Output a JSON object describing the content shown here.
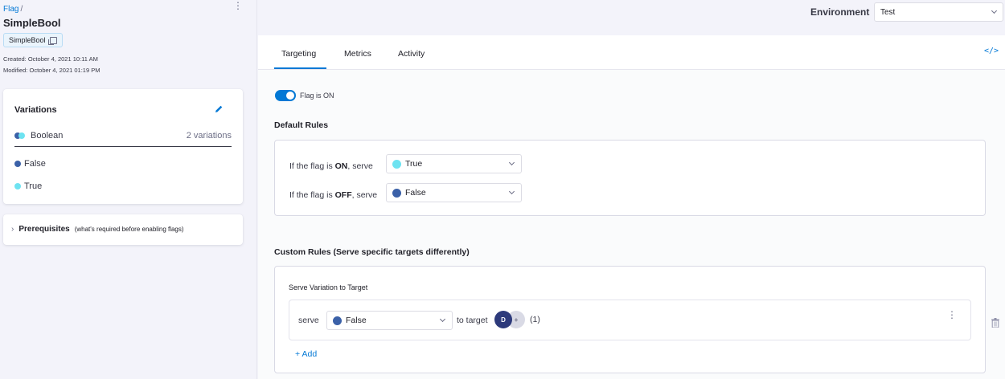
{
  "breadcrumb": {
    "parent": "Flag",
    "separator": "/"
  },
  "flag": {
    "title": "SimpleBool",
    "identifier": "SimpleBool",
    "created": "Created: October 4, 2021 10:11 AM",
    "modified": "Modified: October 4, 2021 01:19 PM"
  },
  "variations": {
    "title": "Variations",
    "kind": "Boolean",
    "count": "2 variations",
    "items": [
      {
        "label": "False",
        "color": "#3b61a8"
      },
      {
        "label": "True",
        "color": "#6ee3f1"
      }
    ]
  },
  "prerequisites": {
    "label": "Prerequisites",
    "sub": "(what's required before enabling flags)"
  },
  "environment": {
    "label": "Environment",
    "value": "Test"
  },
  "tabs": [
    {
      "label": "Targeting",
      "active": true
    },
    {
      "label": "Metrics",
      "active": false
    },
    {
      "label": "Activity",
      "active": false
    }
  ],
  "code_icon": "</>",
  "flag_toggle": {
    "label": "Flag is ON",
    "on": true
  },
  "default_rules": {
    "title": "Default Rules",
    "on_rule": {
      "prefix": "If the flag is ",
      "state": "ON",
      "suffix": ", serve",
      "value": "True"
    },
    "off_rule": {
      "prefix": "If the flag is ",
      "state": "OFF",
      "suffix": ", serve",
      "value": "False"
    }
  },
  "custom_rules": {
    "title": "Custom Rules (Serve specific targets differently)",
    "panel_title": "Serve Variation to Target",
    "serve_label": "serve",
    "serve_value": "False",
    "to_target": "to target",
    "avatar_initial": "D",
    "avatar_more": "+",
    "target_count": "(1)",
    "add_label": "+ Add"
  },
  "colors": {
    "accent": "#0278d5",
    "false_dot": "#3b61a8",
    "true_dot": "#6ee3f1"
  }
}
